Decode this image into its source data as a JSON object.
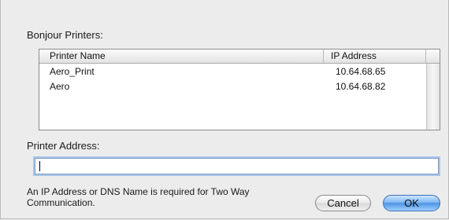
{
  "dialog": {
    "bonjour_label": "Bonjour Printers:",
    "table": {
      "columns": [
        "Printer Name",
        "IP Address"
      ],
      "rows": [
        {
          "name": "Aero_Print",
          "ip": "10.64.68.65"
        },
        {
          "name": "Aero",
          "ip": "10.64.68.82"
        }
      ]
    },
    "address_label": "Printer Address:",
    "address_input": {
      "value": "",
      "placeholder": ""
    },
    "note": "An IP Address or DNS Name is required for Two Way Communication.",
    "buttons": {
      "cancel": "Cancel",
      "ok": "OK"
    }
  },
  "colors": {
    "default_button": "#4d95e6",
    "focus_ring": "#a9c6ea"
  }
}
